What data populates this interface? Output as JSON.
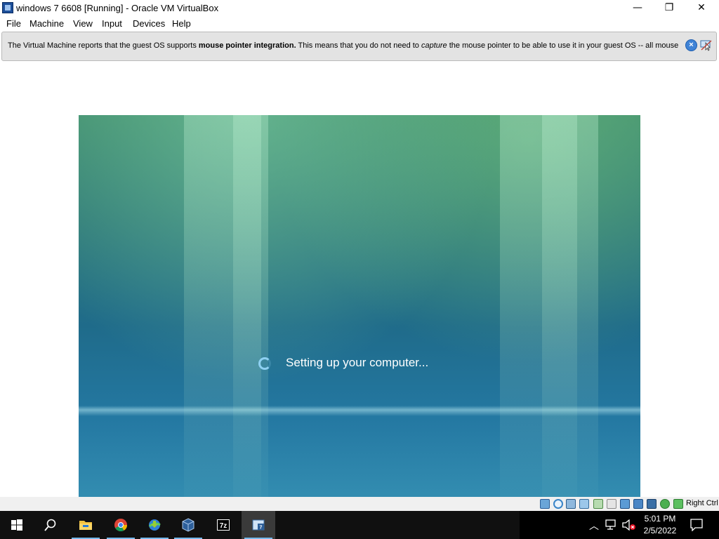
{
  "window": {
    "title": "windows 7 6608 [Running] - Oracle VM VirtualBox",
    "minimize_glyph": "—",
    "maximize_glyph": "❐",
    "close_glyph": "✕"
  },
  "menu": [
    "File",
    "Machine",
    "View",
    "Input",
    "Devices",
    "Help"
  ],
  "banner": {
    "text_part1": "The Virtual Machine reports that the guest OS supports ",
    "text_bold": "mouse pointer integration.",
    "text_part2": " This means that you do not need to ",
    "text_italic": "capture",
    "text_part3": " the mouse pointer to be able to use it in your guest OS -- all mouse"
  },
  "vm_screen": {
    "status_text": "Setting up your computer..."
  },
  "statusbar": {
    "host_key": "Right Ctrl",
    "icons": [
      "hard-disk-icon",
      "optical-drive-icon",
      "audio-icon",
      "network-icon",
      "usb-icon",
      "shared-folders-icon",
      "display-icon",
      "video-capture-icon",
      "virtualization-icon",
      "mouse-integration-icon",
      "keyboard-icon"
    ]
  },
  "taskbar": {
    "apps": [
      "start-button",
      "search-button",
      "file-explorer",
      "chrome",
      "idm",
      "virtualbox",
      "7zip",
      "vm-windows7"
    ],
    "clock_time": "5:01 PM",
    "clock_date": "2/5/2022",
    "accent": "#76b9ed"
  }
}
